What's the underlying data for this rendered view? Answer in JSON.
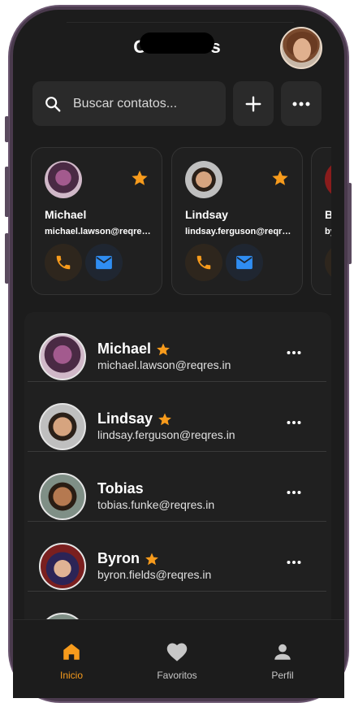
{
  "header": {
    "title": "Contactos"
  },
  "search": {
    "placeholder": "Buscar contatos..."
  },
  "favorites": [
    {
      "name": "Michael",
      "email": "michael.lawson@reqres.in"
    },
    {
      "name": "Lindsay",
      "email": "lindsay.ferguson@reqres.in"
    },
    {
      "name": "Byron",
      "email": "byron.fields@reqres.in"
    }
  ],
  "contacts": [
    {
      "name": "Michael",
      "email": "michael.lawson@reqres.in",
      "favorite": true
    },
    {
      "name": "Lindsay",
      "email": "lindsay.ferguson@reqres.in",
      "favorite": true
    },
    {
      "name": "Tobias",
      "email": "tobias.funke@reqres.in",
      "favorite": false
    },
    {
      "name": "Byron",
      "email": "byron.fields@reqres.in",
      "favorite": true
    }
  ],
  "nav": {
    "home": "Inicio",
    "favorites": "Favoritos",
    "profile": "Perfil"
  },
  "colors": {
    "accent": "#f79b1c",
    "mail": "#2f8df2",
    "background": "#1c1c1c"
  }
}
